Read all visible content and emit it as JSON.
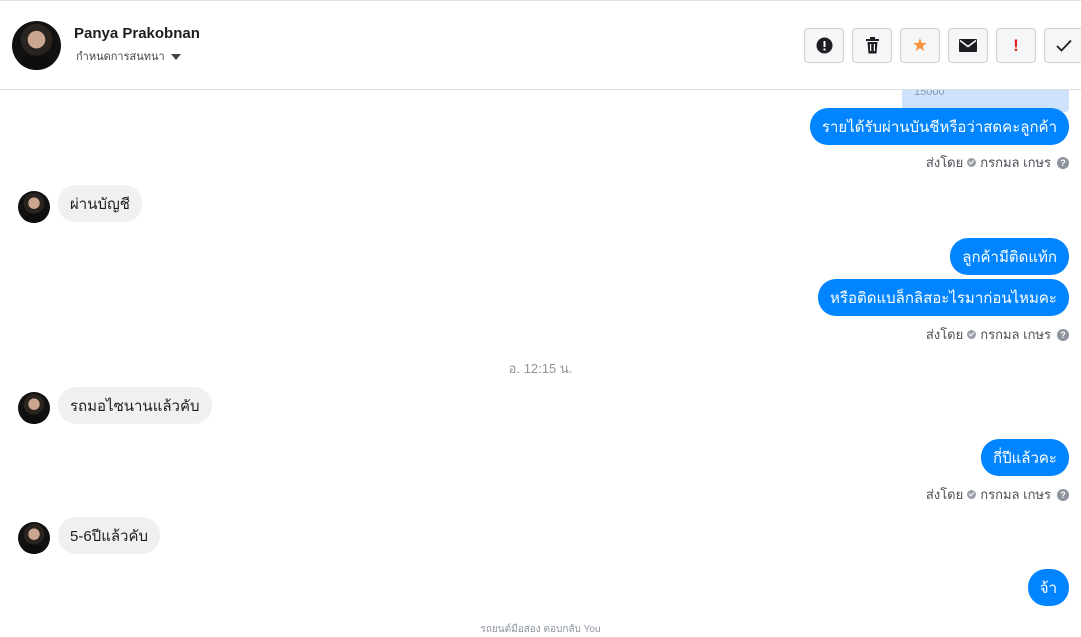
{
  "header": {
    "contact_name": "Panya Prakobnan",
    "assign_label": "กำหนดการสนทนา",
    "toolbar": [
      {
        "name": "info-button",
        "icon": "info-circle-icon"
      },
      {
        "name": "delete-button",
        "icon": "trash-icon"
      },
      {
        "name": "star-button",
        "icon": "star-icon"
      },
      {
        "name": "mark-unread-button",
        "icon": "envelope-icon"
      },
      {
        "name": "spam-button",
        "icon": "exclamation-icon"
      },
      {
        "name": "done-button",
        "icon": "check-icon"
      }
    ]
  },
  "chat": {
    "partial_prev_message": "15000",
    "messages": [
      {
        "direction": "out",
        "text": "รายได้รับผ่านบันชีหรือว่าสดคะลูกค้า"
      },
      {
        "direction": "in",
        "text": "ผ่านบัญชี"
      },
      {
        "direction": "out",
        "text": "ลูกค้ามีติดแท้ก"
      },
      {
        "direction": "out",
        "text": "หรือติดแบล็กลิสอะไรมาก่อนไหมคะ"
      },
      {
        "direction": "in",
        "text": "รถมอไซนานแล้วคับ"
      },
      {
        "direction": "out",
        "text": "กี่ปีแล้วคะ"
      },
      {
        "direction": "in",
        "text": "5-6ปีแล้วคับ"
      },
      {
        "direction": "out",
        "text": "จ้า"
      }
    ],
    "sent_by_label": "ส่งโดย",
    "sent_by_name": "กรกมล เกษร",
    "timestamp": "อ. 12:15 น.",
    "footer_note": "รถยนต์มือสอง ตอบกลับ You"
  },
  "colors": {
    "outgoing_bubble": "#0084ff",
    "incoming_bubble": "#f1f0f0",
    "star": "#f7923a",
    "spam": "#e02020"
  }
}
